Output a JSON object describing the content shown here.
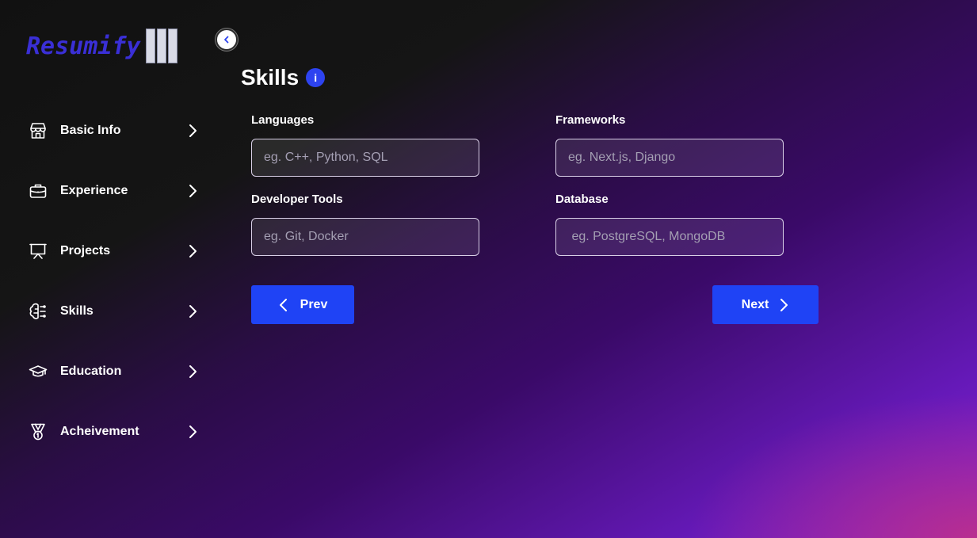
{
  "app": {
    "logo_text": "Resumify",
    "brand_color": "#3a2fd6",
    "accent_color": "#1f43f5"
  },
  "sidebar": {
    "items": [
      {
        "label": "Basic Info",
        "icon": "store-icon"
      },
      {
        "label": "Experience",
        "icon": "briefcase-icon"
      },
      {
        "label": "Projects",
        "icon": "presentation-icon"
      },
      {
        "label": "Skills",
        "icon": "brain-icon"
      },
      {
        "label": "Education",
        "icon": "graduation-cap-icon"
      },
      {
        "label": "Acheivement",
        "icon": "medal-icon"
      }
    ]
  },
  "main": {
    "title": "Skills",
    "fields": {
      "languages": {
        "label": "Languages",
        "placeholder": "eg. C++, Python, SQL",
        "value": ""
      },
      "frameworks": {
        "label": "Frameworks",
        "placeholder": "eg. Next.js, Django",
        "value": ""
      },
      "developer_tools": {
        "label": "Developer Tools",
        "placeholder": "eg. Git, Docker",
        "value": ""
      },
      "database": {
        "label": "Database",
        "placeholder": " eg. PostgreSQL, MongoDB",
        "value": ""
      }
    },
    "buttons": {
      "prev_label": "Prev",
      "next_label": "Next"
    }
  }
}
